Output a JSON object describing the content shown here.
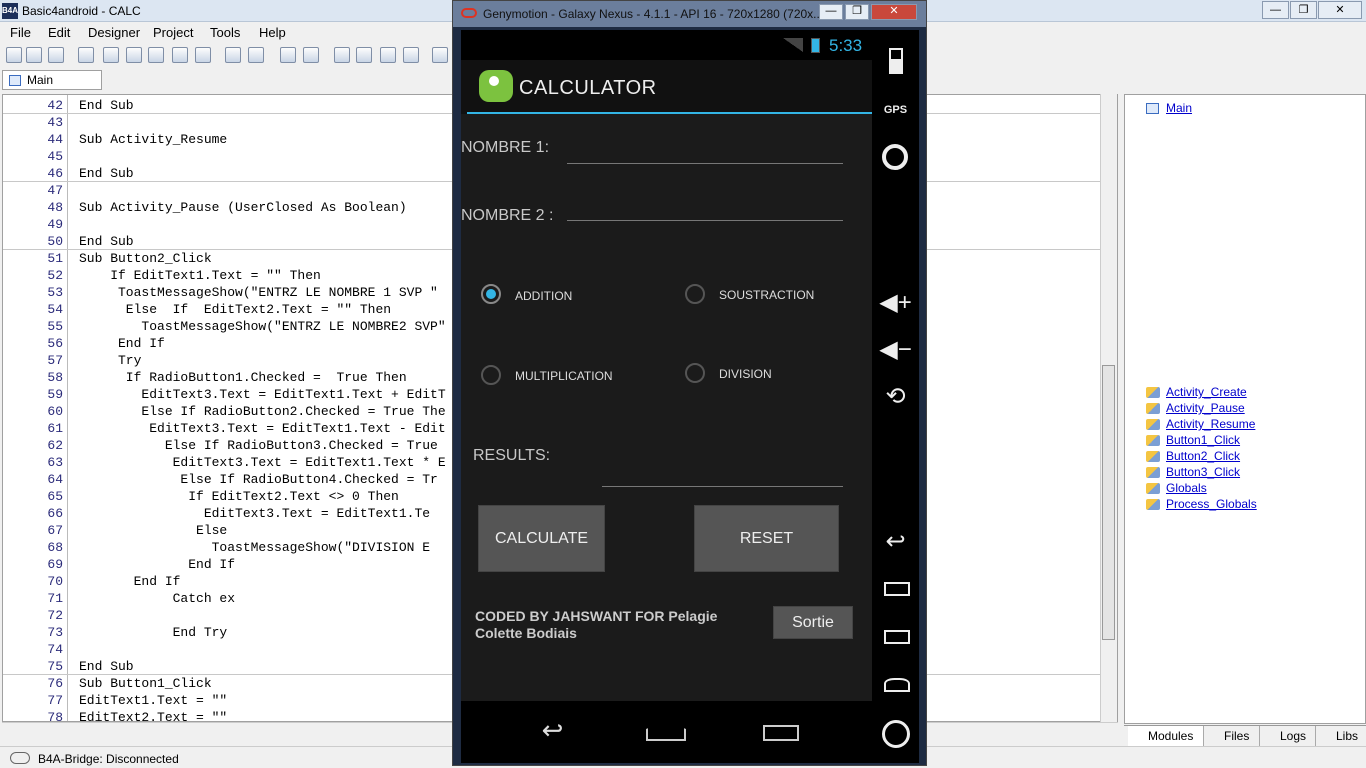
{
  "window": {
    "title": "Basic4android - CALC",
    "logo_text": "B4A",
    "buttons": [
      "—",
      "❐",
      "✕"
    ]
  },
  "menu": [
    "File",
    "Edit",
    "Designer",
    "Project",
    "Tools",
    "Help"
  ],
  "tabs": {
    "main": "Main"
  },
  "code": [
    {
      "n": "42",
      "t": "End Sub",
      "sep": true
    },
    {
      "n": "43",
      "t": ""
    },
    {
      "n": "44",
      "t": "Sub Activity_Resume"
    },
    {
      "n": "45",
      "t": ""
    },
    {
      "n": "46",
      "t": "End Sub",
      "sep": true
    },
    {
      "n": "47",
      "t": ""
    },
    {
      "n": "48",
      "t": "Sub Activity_Pause (UserClosed As Boolean)"
    },
    {
      "n": "49",
      "t": ""
    },
    {
      "n": "50",
      "t": "End Sub",
      "sep": true
    },
    {
      "n": "51",
      "t": "Sub Button2_Click"
    },
    {
      "n": "52",
      "t": "    If EditText1.Text = \"\" Then"
    },
    {
      "n": "53",
      "t": "     ToastMessageShow(\"ENTRZ LE NOMBRE 1 SVP \""
    },
    {
      "n": "54",
      "t": "      Else  If  EditText2.Text = \"\" Then"
    },
    {
      "n": "55",
      "t": "        ToastMessageShow(\"ENTRZ LE NOMBRE2 SVP\""
    },
    {
      "n": "56",
      "t": "     End If"
    },
    {
      "n": "57",
      "t": "     Try"
    },
    {
      "n": "58",
      "t": "      If RadioButton1.Checked =  True Then"
    },
    {
      "n": "59",
      "t": "        EditText3.Text = EditText1.Text + EditT"
    },
    {
      "n": "60",
      "t": "        Else If RadioButton2.Checked = True The"
    },
    {
      "n": "61",
      "t": "         EditText3.Text = EditText1.Text - Edit"
    },
    {
      "n": "62",
      "t": "           Else If RadioButton3.Checked = True"
    },
    {
      "n": "63",
      "t": "            EditText3.Text = EditText1.Text * E"
    },
    {
      "n": "64",
      "t": "             Else If RadioButton4.Checked = Tr"
    },
    {
      "n": "65",
      "t": "              If EditText2.Text <> 0 Then"
    },
    {
      "n": "66",
      "t": "                EditText3.Text = EditText1.Te"
    },
    {
      "n": "67",
      "t": "               Else"
    },
    {
      "n": "68",
      "t": "                 ToastMessageShow(\"DIVISION E"
    },
    {
      "n": "69",
      "t": "              End If"
    },
    {
      "n": "70",
      "t": "       End If"
    },
    {
      "n": "71",
      "t": "            Catch ex"
    },
    {
      "n": "72",
      "t": ""
    },
    {
      "n": "73",
      "t": "            End Try"
    },
    {
      "n": "74",
      "t": ""
    },
    {
      "n": "75",
      "t": "End Sub",
      "sep": true
    },
    {
      "n": "76",
      "t": "Sub Button1_Click"
    },
    {
      "n": "77",
      "t": "EditText1.Text = \"\""
    },
    {
      "n": "78",
      "t": "EditText2.Text = \"\""
    }
  ],
  "modules": {
    "main": "Main"
  },
  "subs": [
    "Activity_Create",
    "Activity_Pause",
    "Activity_Resume",
    "Button1_Click",
    "Button2_Click",
    "Button3_Click",
    "Globals",
    "Process_Globals"
  ],
  "bottom_tabs": [
    "Modules",
    "Files",
    "Logs",
    "Libs"
  ],
  "status": "B4A-Bridge: Disconnected",
  "emulator": {
    "title": "Genymotion - Galaxy Nexus - 4.1.1 - API 16 - 720x1280 (720x...",
    "clock": "5:33",
    "gps": "GPS",
    "app_title": "CALCULATOR",
    "nombre1": "NOMBRE 1:",
    "nombre2": "NOMBRE 2 :",
    "radio_addition": "ADDITION",
    "radio_soustraction": "SOUSTRACTION",
    "radio_multiplication": "MULTIPLICATION",
    "radio_division": "DIVISION",
    "results": "RESULTS:",
    "calculate": "CALCULATE",
    "reset": "RESET",
    "coded_by": "CODED BY JAHSWANT FOR Pelagie Colette Bodiais",
    "sortie": "Sortie"
  }
}
